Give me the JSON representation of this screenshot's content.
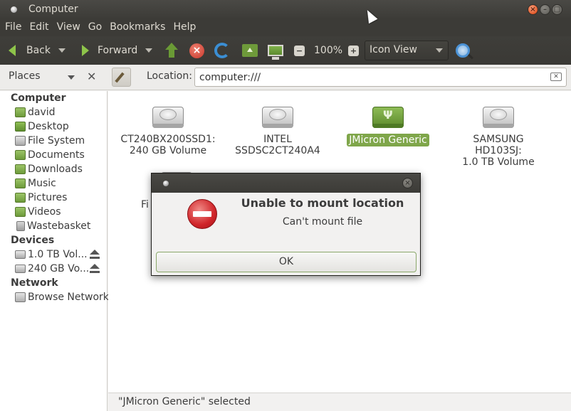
{
  "window": {
    "title": "Computer"
  },
  "menubar": {
    "items": [
      "File",
      "Edit",
      "View",
      "Go",
      "Bookmarks",
      "Help"
    ]
  },
  "toolbar": {
    "back_label": "Back",
    "forward_label": "Forward",
    "zoom_level": "100%",
    "view_mode": "Icon View"
  },
  "locationbar": {
    "places_label": "Places",
    "location_label": "Location:",
    "location_value": "computer:///"
  },
  "sidebar": {
    "sections": [
      {
        "heading": "Computer",
        "items": [
          "david",
          "Desktop",
          "File System",
          "Documents",
          "Downloads",
          "Music",
          "Pictures",
          "Videos",
          "Wastebasket"
        ]
      },
      {
        "heading": "Devices",
        "items": [
          "1.0 TB Vol...",
          "240 GB Vo..."
        ]
      },
      {
        "heading": "Network",
        "items": [
          "Browse Network"
        ]
      }
    ]
  },
  "files": [
    {
      "line1": "CT240BX200SSD1:",
      "line2": "240 GB Volume",
      "icon": "hard-drive-icon"
    },
    {
      "line1": "INTEL",
      "line2": "SSDSC2CT240A4",
      "icon": "hard-drive-icon"
    },
    {
      "line1": "JMicron Generic",
      "line2": "",
      "icon": "usb-drive-icon",
      "selected": true
    },
    {
      "line1": "SAMSUNG HD103SJ:",
      "line2": "1.0 TB Volume",
      "icon": "hard-drive-icon"
    },
    {
      "line1": "Fi",
      "line2": "",
      "icon": "hard-drive-icon"
    }
  ],
  "statusbar": {
    "text": "\"JMicron Generic\" selected"
  },
  "dialog": {
    "heading": "Unable to mount location",
    "message": "Can't mount file",
    "ok_label": "OK"
  },
  "colors": {
    "selection": "#7fa64a",
    "error": "#d0252a",
    "titlebar": "#3c3b37"
  }
}
